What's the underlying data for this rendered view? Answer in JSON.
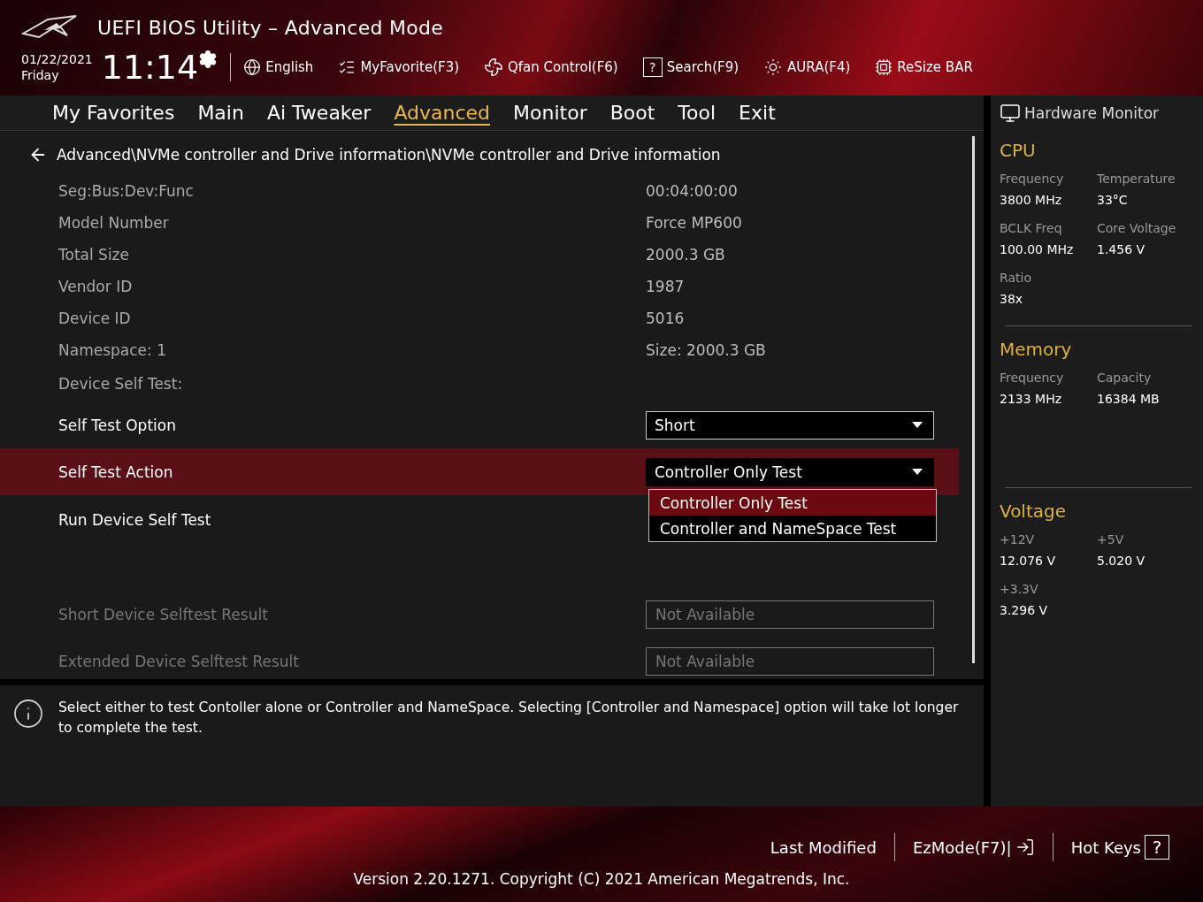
{
  "header": {
    "title": "UEFI BIOS Utility – Advanced Mode",
    "date": "01/22/2021",
    "day": "Friday",
    "time": "11:14"
  },
  "toolbar": [
    {
      "label": "English"
    },
    {
      "label": "MyFavorite(F3)"
    },
    {
      "label": "Qfan Control(F6)"
    },
    {
      "icon_char": "?",
      "label": "Search(F9)"
    },
    {
      "label": "AURA(F4)"
    },
    {
      "label": "ReSize BAR"
    }
  ],
  "tabs": [
    {
      "label": "My Favorites",
      "selected": false
    },
    {
      "label": "Main",
      "selected": false
    },
    {
      "label": "Ai Tweaker",
      "selected": false
    },
    {
      "label": "Advanced",
      "selected": true
    },
    {
      "label": "Monitor",
      "selected": false
    },
    {
      "label": "Boot",
      "selected": false
    },
    {
      "label": "Tool",
      "selected": false
    },
    {
      "label": "Exit",
      "selected": false
    }
  ],
  "breadcrumb": "Advanced\\NVMe controller and Drive information\\NVMe controller and Drive information",
  "rows": [
    {
      "kind": "info",
      "label": "Seg:Bus:Dev:Func",
      "value": "00:04:00:00"
    },
    {
      "kind": "info",
      "label": "Model Number",
      "value": "Force MP600"
    },
    {
      "kind": "info",
      "label": "Total Size",
      "value": "2000.3 GB"
    },
    {
      "kind": "info",
      "label": "Vendor ID",
      "value": "1987"
    },
    {
      "kind": "info",
      "label": "Device ID",
      "value": "5016"
    },
    {
      "kind": "info",
      "label": "Namespace: 1",
      "value": "Size: 2000.3 GB"
    },
    {
      "kind": "section",
      "label": "Device Self Test:"
    },
    {
      "kind": "dropdown",
      "label": "Self Test Option",
      "value": "Short",
      "selected": false
    },
    {
      "kind": "dropdown",
      "label": "Self Test Action",
      "value": "Controller Only Test",
      "selected": true,
      "menu": [
        {
          "label": "Controller Only Test",
          "selected": true
        },
        {
          "label": "Controller and NameSpace Test",
          "selected": false
        }
      ]
    },
    {
      "kind": "action",
      "label": "Run Device Self Test"
    },
    {
      "kind": "readonly",
      "label": "Short Device Selftest Result",
      "value": "Not Available"
    },
    {
      "kind": "readonly",
      "label": "Extended Device Selftest Result",
      "value": "Not Available"
    }
  ],
  "help_text": "Select either to test Contoller alone or Controller and NameSpace. Selecting [Controller and Namespace] option will take lot longer to complete the test.",
  "hardware_monitor": {
    "title": "Hardware Monitor",
    "sections": [
      {
        "title": "CPU",
        "items": [
          {
            "label": "Frequency",
            "value": "3800 MHz"
          },
          {
            "label": "Temperature",
            "value": "33°C"
          },
          {
            "label": "BCLK Freq",
            "value": "100.00 MHz"
          },
          {
            "label": "Core Voltage",
            "value": "1.456 V"
          },
          {
            "label": "Ratio",
            "value": "38x"
          }
        ]
      },
      {
        "title": "Memory",
        "items": [
          {
            "label": "Frequency",
            "value": "2133 MHz"
          },
          {
            "label": "Capacity",
            "value": "16384 MB"
          }
        ]
      },
      {
        "title": "Voltage",
        "items": [
          {
            "label": "+12V",
            "value": "12.076 V"
          },
          {
            "label": "+5V",
            "value": "5.020 V"
          },
          {
            "label": "+3.3V",
            "value": "3.296 V"
          }
        ]
      }
    ]
  },
  "footer": {
    "buttons": [
      {
        "label": "Last Modified"
      },
      {
        "label": "EzMode(F7)|"
      },
      {
        "label": "Hot Keys",
        "icon_char": "?"
      }
    ],
    "version": "Version 2.20.1271. Copyright (C) 2021 American Megatrends, Inc."
  }
}
